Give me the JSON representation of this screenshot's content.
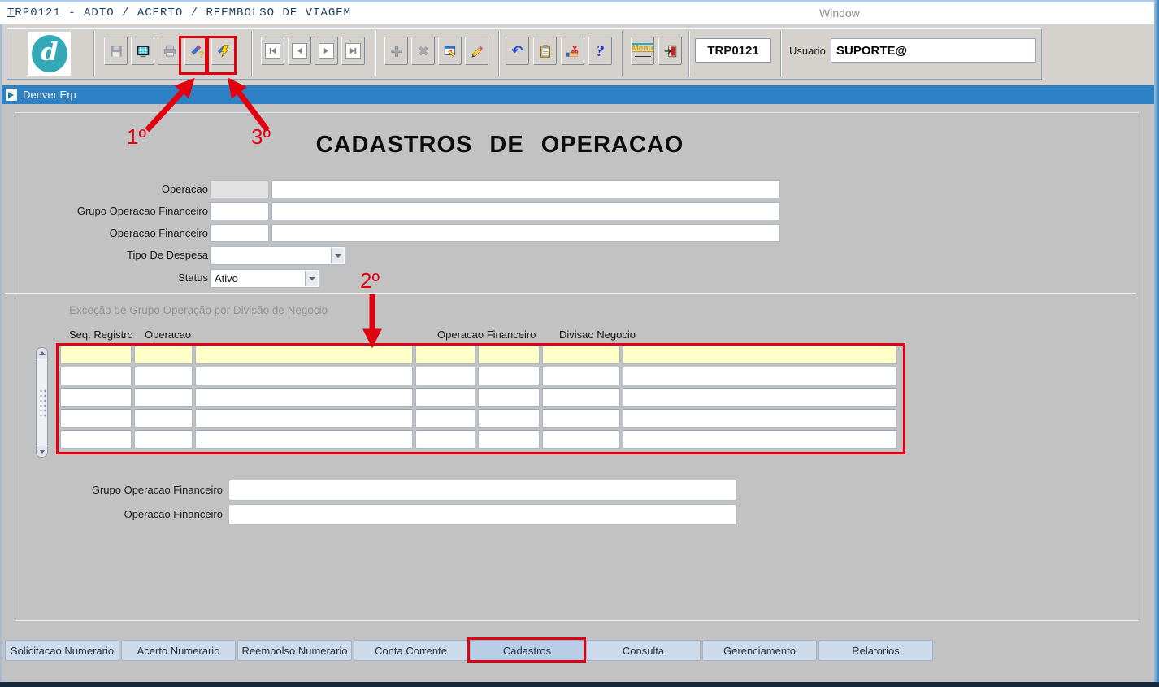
{
  "menubar": {
    "title_first_letter": "T",
    "title_rest": "RP0121 - ADTO / ACERTO / REEMBOLSO DE VIAGEM",
    "window_menu": "Window"
  },
  "toolbar": {
    "logo_letter": "d",
    "menu_icon_label": "Menu",
    "undo_glyph": "↶",
    "help_glyph": "?",
    "code_box": "TRP0121",
    "user_label": "Usuario",
    "user_value": "SUPORTE@"
  },
  "window_bar": {
    "title": "Denver Erp"
  },
  "page": {
    "title": "CADASTROS DE OPERACAO"
  },
  "form": {
    "labels": {
      "operacao": "Operacao",
      "grupo_operacao_financeiro": "Grupo Operacao Financeiro",
      "operacao_financeiro": "Operacao Financeiro",
      "tipo_de_despesa": "Tipo De Despesa",
      "status": "Status"
    },
    "values": {
      "operacao_code": "",
      "operacao_desc": "",
      "grupo_code": "",
      "grupo_desc": "",
      "opfin_code": "",
      "opfin_desc": "",
      "tipo_de_despesa": "",
      "status": "Ativo"
    }
  },
  "exception_section": {
    "title": "Exceção de Grupo Operação por Divisão de Negocio",
    "column_headers": [
      "Seq. Registro",
      "Operacao",
      "Operacao Financeiro",
      "Divisao Negocio"
    ],
    "row_count": 5,
    "selected_row_index": 0
  },
  "footer_form": {
    "grupo_operacao_financeiro_label": "Grupo Operacao Financeiro",
    "grupo_operacao_financeiro_value": "",
    "operacao_financeiro_label": "Operacao Financeiro",
    "operacao_financeiro_value": ""
  },
  "footer_tabs": {
    "items": [
      {
        "label": "Solicitacao Numerario",
        "active": false
      },
      {
        "label": "Acerto Numerario",
        "active": false
      },
      {
        "label": "Reembolso Numerario",
        "active": false
      },
      {
        "label": "Conta Corrente",
        "active": false
      },
      {
        "label": "Cadastros",
        "active": true
      },
      {
        "label": "Consulta",
        "active": false
      },
      {
        "label": "Gerenciamento",
        "active": false
      },
      {
        "label": "Relatorios",
        "active": false
      }
    ]
  },
  "annotations": {
    "step1": "1º",
    "step2": "2º",
    "step3": "3º",
    "highlight_color": "#e3000e"
  },
  "colors": {
    "titlebar_blue": "#2e81c4",
    "accent_red": "#e3000e",
    "selected_row_yellow": "#ffffc8",
    "tab_bg": "#cddaeb",
    "tab_active_bg": "#b9cde7"
  }
}
